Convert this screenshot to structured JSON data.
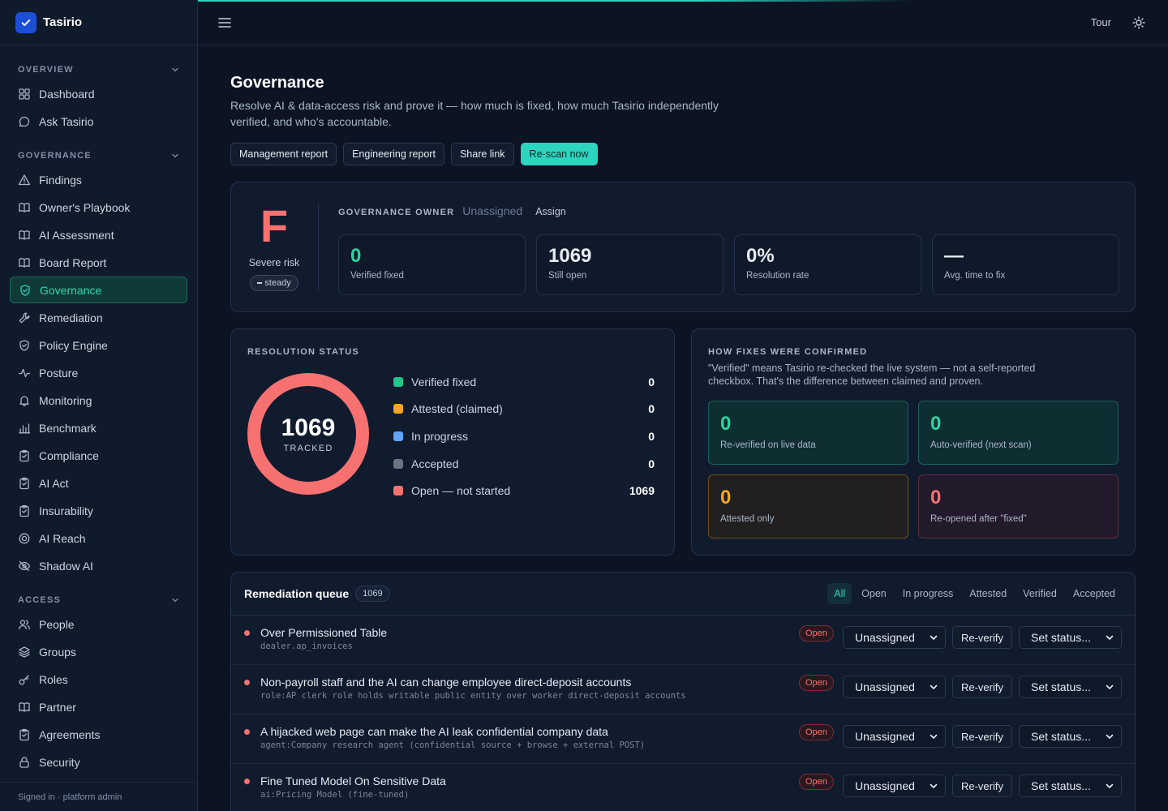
{
  "app": {
    "name": "Tasirio",
    "signed_in": "Signed in · platform admin"
  },
  "sidebar": {
    "sections": [
      {
        "title": "OVERVIEW",
        "items": [
          {
            "label": "Dashboard",
            "icon": "grid-icon"
          },
          {
            "label": "Ask Tasirio",
            "icon": "chat-icon"
          }
        ]
      },
      {
        "title": "GOVERNANCE",
        "items": [
          {
            "label": "Findings",
            "icon": "warning-icon"
          },
          {
            "label": "Owner's Playbook",
            "icon": "book-icon"
          },
          {
            "label": "AI Assessment",
            "icon": "book-icon"
          },
          {
            "label": "Board Report",
            "icon": "book-icon"
          },
          {
            "label": "Governance",
            "icon": "shield-check-icon",
            "active": true
          },
          {
            "label": "Remediation",
            "icon": "wrench-icon"
          },
          {
            "label": "Policy Engine",
            "icon": "shield-icon"
          },
          {
            "label": "Posture",
            "icon": "activity-icon"
          },
          {
            "label": "Monitoring",
            "icon": "bell-icon"
          },
          {
            "label": "Benchmark",
            "icon": "bar-chart-icon"
          },
          {
            "label": "Compliance",
            "icon": "clipboard-icon"
          },
          {
            "label": "AI Act",
            "icon": "clipboard-icon"
          },
          {
            "label": "Insurability",
            "icon": "clipboard-icon"
          },
          {
            "label": "AI Reach",
            "icon": "target-icon"
          },
          {
            "label": "Shadow AI",
            "icon": "eye-off-icon"
          }
        ]
      },
      {
        "title": "ACCESS",
        "items": [
          {
            "label": "People",
            "icon": "users-icon"
          },
          {
            "label": "Groups",
            "icon": "layers-icon"
          },
          {
            "label": "Roles",
            "icon": "key-icon"
          },
          {
            "label": "Partner",
            "icon": "book-icon"
          },
          {
            "label": "Agreements",
            "icon": "clipboard-icon"
          },
          {
            "label": "Security",
            "icon": "lock-icon"
          }
        ]
      }
    ]
  },
  "topbar": {
    "tour": "Tour"
  },
  "page": {
    "title": "Governance",
    "subtitle": "Resolve AI & data-access risk and prove it — how much is fixed, how much Tasirio independently verified, and who's accountable.",
    "actions": [
      "Management report",
      "Engineering report",
      "Share link",
      "Re-scan now"
    ]
  },
  "score": {
    "grade": "F",
    "grade_label": "Severe risk",
    "trend": "steady",
    "owner_label": "GOVERNANCE OWNER",
    "owner_value": "Unassigned",
    "assign": "Assign",
    "stats": [
      {
        "value": "0",
        "label": "Verified fixed",
        "accent": "green"
      },
      {
        "value": "1069",
        "label": "Still open"
      },
      {
        "value": "0%",
        "label": "Resolution rate"
      },
      {
        "value": "—",
        "label": "Avg. time to fix"
      }
    ]
  },
  "resolution": {
    "title": "RESOLUTION STATUS",
    "total": "1069",
    "total_caption": "TRACKED",
    "rows": [
      {
        "label": "Verified fixed",
        "value": "0",
        "color": "#22c58b"
      },
      {
        "label": "Attested (claimed)",
        "value": "0",
        "color": "#f5a524"
      },
      {
        "label": "In progress",
        "value": "0",
        "color": "#60a5fa"
      },
      {
        "label": "Accepted",
        "value": "0",
        "color": "#6b7280"
      },
      {
        "label": "Open — not started",
        "value": "1069",
        "color": "#f87171"
      }
    ]
  },
  "confirmation": {
    "title": "HOW FIXES WERE CONFIRMED",
    "description": "\"Verified\" means Tasirio re-checked the live system — not a self-reported checkbox. That's the difference between claimed and proven.",
    "boxes": [
      {
        "value": "0",
        "label": "Re-verified on live data",
        "tone": "teal"
      },
      {
        "value": "0",
        "label": "Auto-verified (next scan)",
        "tone": "teal"
      },
      {
        "value": "0",
        "label": "Attested only",
        "tone": "amber"
      },
      {
        "value": "0",
        "label": "Re-opened after \"fixed\"",
        "tone": "red"
      }
    ]
  },
  "queue": {
    "title": "Remediation queue",
    "count": "1069",
    "filters": [
      "All",
      "Open",
      "In progress",
      "Attested",
      "Verified",
      "Accepted"
    ],
    "active_filter": "All",
    "rows": [
      {
        "title": "Over Permissioned Table",
        "sub": "dealer.ap_invoices",
        "status": "Open",
        "assignee": "Unassigned",
        "reverify": "Re-verify",
        "set_status": "Set status..."
      },
      {
        "title": "Non-payroll staff and the AI can change employee direct-deposit accounts",
        "sub": "role:AP clerk role holds writable public entity over worker direct-deposit accounts",
        "status": "Open",
        "assignee": "Unassigned",
        "reverify": "Re-verify",
        "set_status": "Set status..."
      },
      {
        "title": "A hijacked web page can make the AI leak confidential company data",
        "sub": "agent:Company research agent (confidential source + browse + external POST)",
        "status": "Open",
        "assignee": "Unassigned",
        "reverify": "Re-verify",
        "set_status": "Set status..."
      },
      {
        "title": "Fine Tuned Model On Sensitive Data",
        "sub": "ai:Pricing Model (fine-tuned)",
        "status": "Open",
        "assignee": "Unassigned",
        "reverify": "Re-verify",
        "set_status": "Set status..."
      }
    ]
  }
}
